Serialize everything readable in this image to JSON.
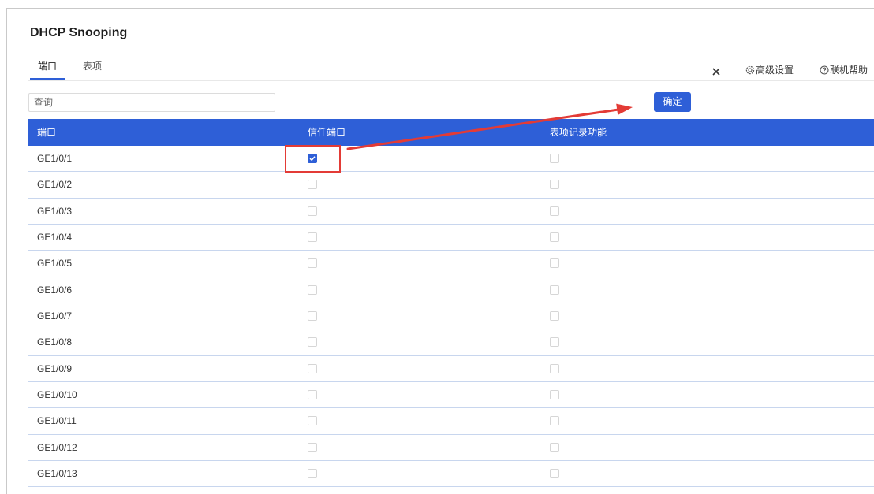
{
  "page": {
    "title": "DHCP Snooping"
  },
  "tabs": [
    {
      "label": "端口",
      "active": true
    },
    {
      "label": "表项",
      "active": false
    }
  ],
  "toolbar": {
    "close_icon": "close-icon",
    "advanced_icon": "gear-icon",
    "advanced_label": "高级设置",
    "help_icon": "help-icon",
    "help_label": "联机帮助"
  },
  "search": {
    "placeholder": "查询"
  },
  "confirm_button": {
    "label": "确定"
  },
  "table": {
    "columns": [
      "端口",
      "信任端口",
      "表项记录功能"
    ],
    "rows": [
      {
        "port": "GE1/0/1",
        "trusted": true,
        "record": false
      },
      {
        "port": "GE1/0/2",
        "trusted": false,
        "record": false
      },
      {
        "port": "GE1/0/3",
        "trusted": false,
        "record": false
      },
      {
        "port": "GE1/0/4",
        "trusted": false,
        "record": false
      },
      {
        "port": "GE1/0/5",
        "trusted": false,
        "record": false
      },
      {
        "port": "GE1/0/6",
        "trusted": false,
        "record": false
      },
      {
        "port": "GE1/0/7",
        "trusted": false,
        "record": false
      },
      {
        "port": "GE1/0/8",
        "trusted": false,
        "record": false
      },
      {
        "port": "GE1/0/9",
        "trusted": false,
        "record": false
      },
      {
        "port": "GE1/0/10",
        "trusted": false,
        "record": false
      },
      {
        "port": "GE1/0/11",
        "trusted": false,
        "record": false
      },
      {
        "port": "GE1/0/12",
        "trusted": false,
        "record": false
      },
      {
        "port": "GE1/0/13",
        "trusted": false,
        "record": false
      }
    ]
  },
  "colors": {
    "accent": "#2e5fd7",
    "annotation": "#e33b36",
    "row_divider": "#c8d6ee"
  }
}
